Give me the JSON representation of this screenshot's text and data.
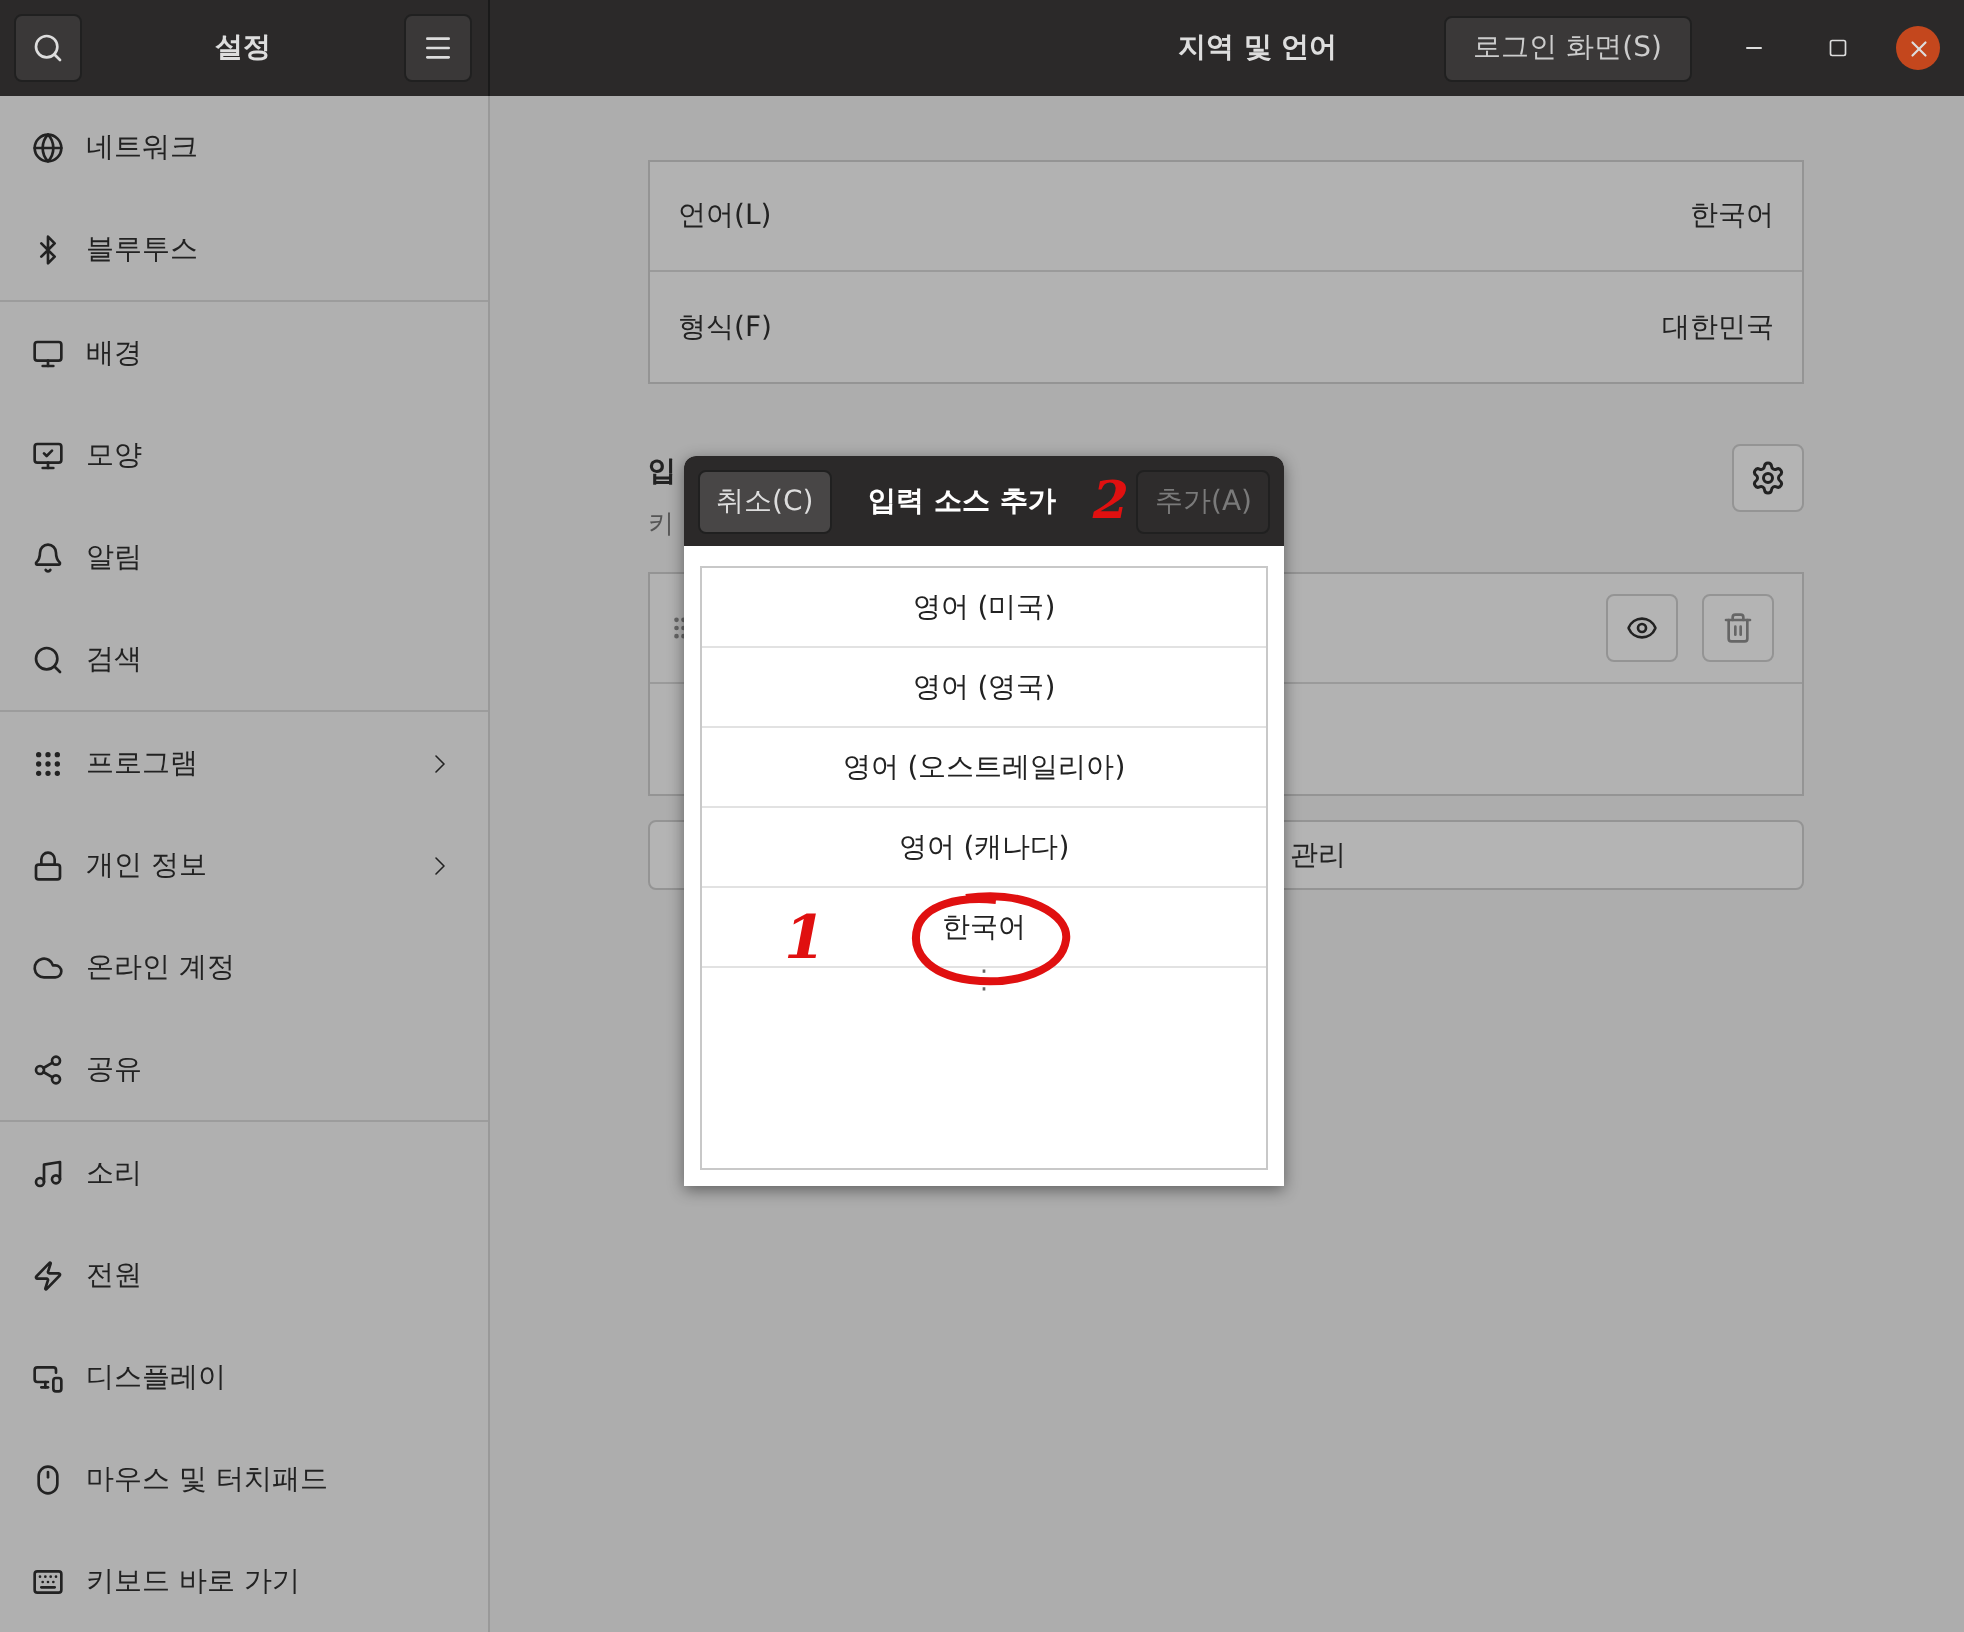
{
  "window": {
    "sidebar_title": "설정",
    "title": "지역 및 언어",
    "login_button": "로그인 화면(S)"
  },
  "sidebar": {
    "groups": [
      [
        {
          "label": "네트워크",
          "expandable": false
        },
        {
          "label": "블루투스",
          "expandable": false
        }
      ],
      [
        {
          "label": "배경",
          "expandable": false
        },
        {
          "label": "모양",
          "expandable": false
        },
        {
          "label": "알림",
          "expandable": false
        },
        {
          "label": "검색",
          "expandable": false
        }
      ],
      [
        {
          "label": "프로그램",
          "expandable": true
        },
        {
          "label": "개인 정보",
          "expandable": true
        },
        {
          "label": "온라인 계정",
          "expandable": false
        },
        {
          "label": "공유",
          "expandable": false
        }
      ],
      [
        {
          "label": "소리",
          "expandable": false
        },
        {
          "label": "전원",
          "expandable": false
        },
        {
          "label": "디스플레이",
          "expandable": false
        },
        {
          "label": "마우스 및 터치패드",
          "expandable": false
        },
        {
          "label": "키보드 바로 가기",
          "expandable": false
        }
      ]
    ]
  },
  "language_settings": [
    {
      "label": "언어(L)",
      "value": "한국어"
    },
    {
      "label": "형식(F)",
      "value": "대한민국"
    }
  ],
  "input_sources": {
    "heading": "입",
    "subtitle": "키",
    "manage_button": "관리"
  },
  "dialog": {
    "cancel_button": "취소(C)",
    "title": "입력 소스 추가",
    "add_button": {
      "label": "추가(A)",
      "disabled": true
    },
    "items": [
      {
        "label": "영어 (미국)"
      },
      {
        "label": "영어 (영국)"
      },
      {
        "label": "영어 (오스트레일리아)"
      },
      {
        "label": "영어 (캐나다)"
      },
      {
        "label": "한국어"
      }
    ],
    "more": "⋮"
  },
  "annotations": [
    {
      "label": "1"
    },
    {
      "label": "2"
    }
  ]
}
